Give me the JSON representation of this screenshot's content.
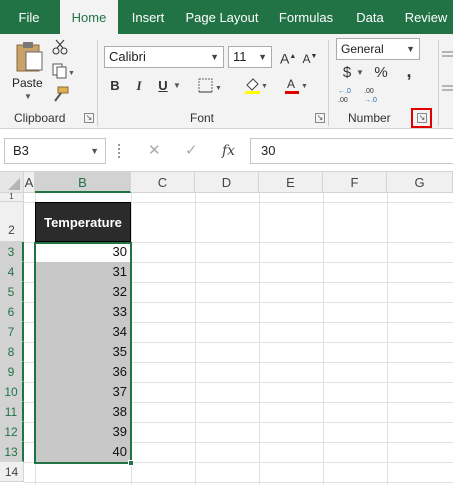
{
  "tabs": [
    "File",
    "Home",
    "Insert",
    "Page Layout",
    "Formulas",
    "Data",
    "Review"
  ],
  "ribbon": {
    "clipboard_label": "Clipboard",
    "paste_label": "Paste",
    "font_label": "Font",
    "font_name": "Calibri",
    "font_size": "11",
    "number_label": "Number",
    "number_format": "General",
    "bold": "B",
    "italic": "I",
    "underline": "U",
    "currency": "$",
    "percent": "%",
    "comma": ","
  },
  "formula_bar": {
    "name_box": "B3",
    "cancel": "✕",
    "enter": "✓",
    "fx": "fx",
    "value": "30"
  },
  "columns": [
    "A",
    "B",
    "C",
    "D",
    "E",
    "F",
    "G"
  ],
  "rows": [
    "1",
    "2",
    "3",
    "4",
    "5",
    "6",
    "7",
    "8",
    "9",
    "10",
    "11",
    "12",
    "13",
    "14"
  ],
  "table": {
    "header": "Temperature",
    "values": [
      "30",
      "31",
      "32",
      "33",
      "34",
      "35",
      "36",
      "37",
      "38",
      "39",
      "40"
    ]
  },
  "colors": {
    "accent": "#217346",
    "header_fill": "#2b2b2b",
    "selection_fill": "#c8c8c8",
    "highlight": "#e00000"
  }
}
